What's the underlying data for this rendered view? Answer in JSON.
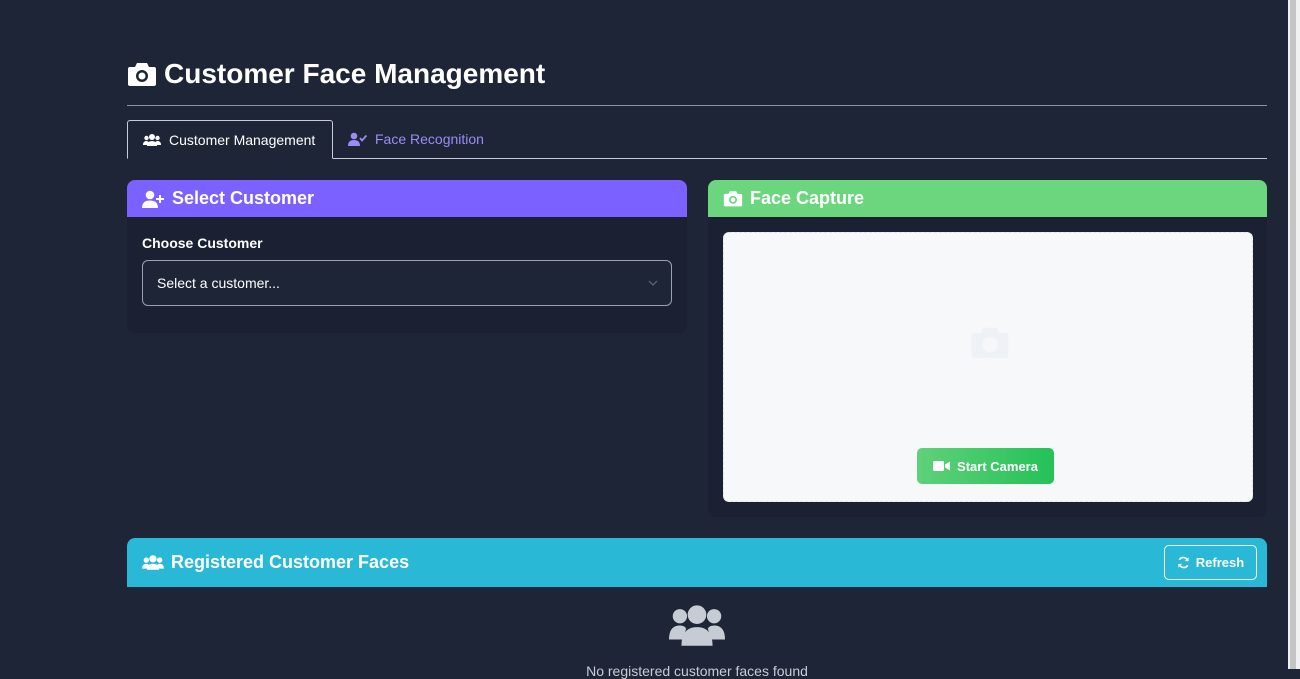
{
  "page": {
    "title": "Customer Face Management",
    "title_icon": "camera-icon"
  },
  "tabs": [
    {
      "label": "Customer Management",
      "icon": "users-icon",
      "active": true
    },
    {
      "label": "Face Recognition",
      "icon": "user-check-icon",
      "active": false
    }
  ],
  "select_customer": {
    "header": "Select Customer",
    "header_icon": "user-plus-icon",
    "field_label": "Choose Customer",
    "select_value": "Select a customer..."
  },
  "face_capture": {
    "header": "Face Capture",
    "header_icon": "camera-icon",
    "start_camera_label": "Start Camera",
    "button_icon": "video-icon"
  },
  "registered": {
    "header": "Registered Customer Faces",
    "header_icon": "users-icon",
    "refresh_label": "Refresh",
    "empty_text": "No registered customer faces found"
  },
  "colors": {
    "background": "#1e2536",
    "select_header": "#7b61ff",
    "capture_header": "#6cd67e",
    "registered_header": "#29b8d6",
    "start_button": "#25c157",
    "tab_inactive": "#9b8cf5"
  }
}
